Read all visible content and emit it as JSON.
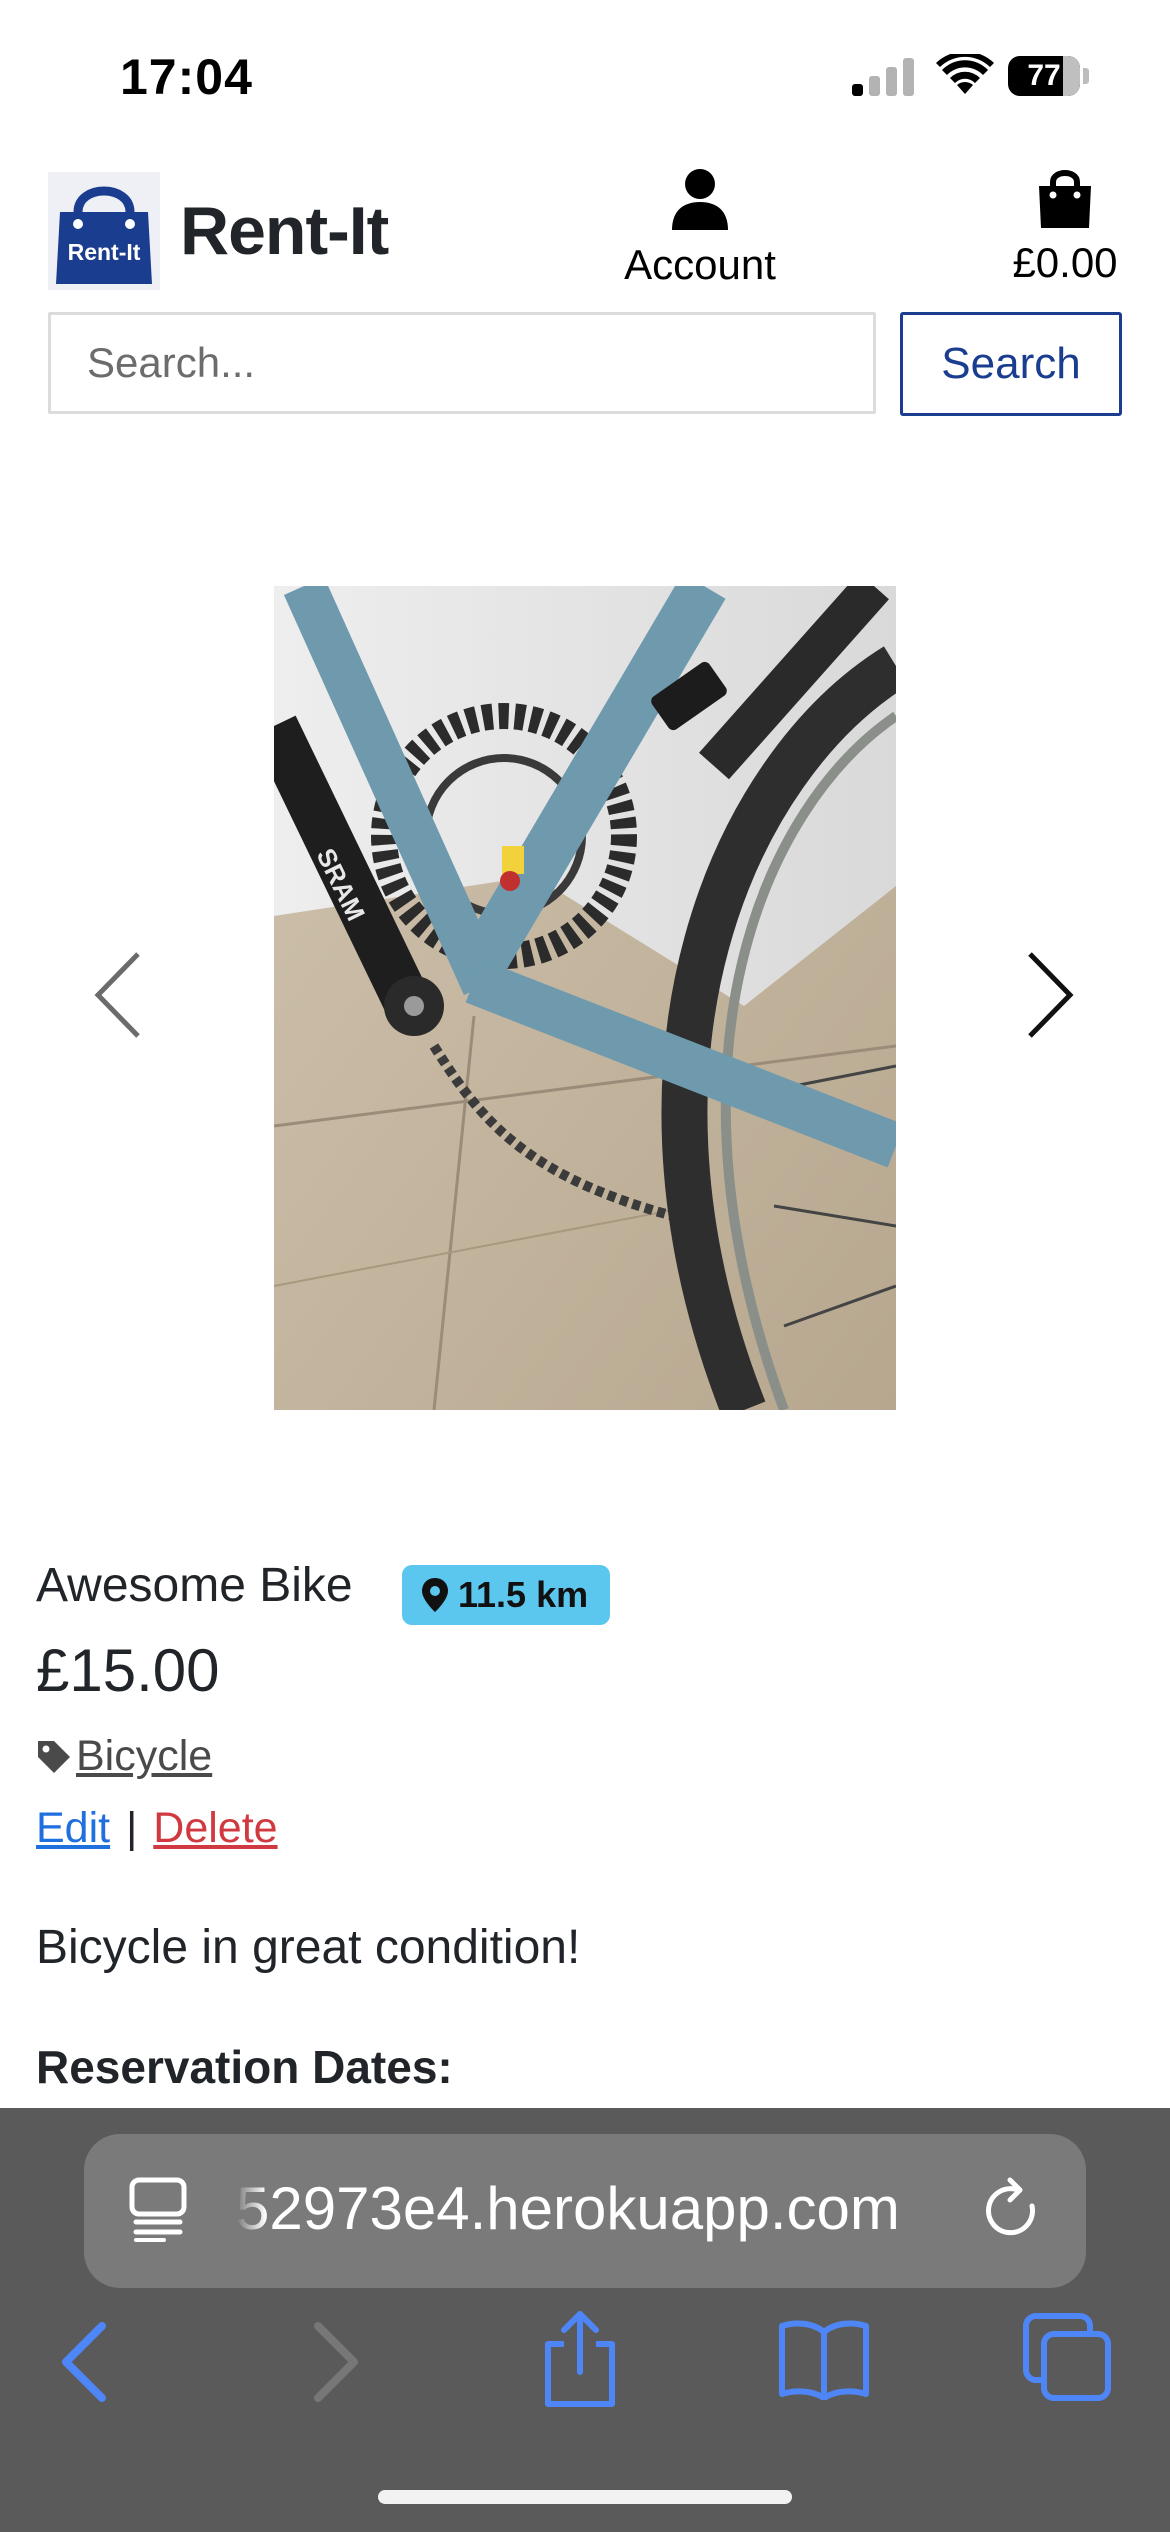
{
  "status_bar": {
    "time": "17:04",
    "battery": "77",
    "battery_level": 0.77
  },
  "header": {
    "logo_text": "Rent-It",
    "brand": "Rent-It",
    "account_label": "Account",
    "cart_total": "£0.00",
    "icons": {
      "account": "person-icon",
      "cart": "shopping-bag-icon"
    }
  },
  "search": {
    "placeholder": "Search...",
    "value": "",
    "button_label": "Search"
  },
  "carousel": {
    "prev_icon": "chevron-left-icon",
    "next_icon": "chevron-right-icon"
  },
  "product": {
    "title": "Awesome Bike",
    "distance": "11.5 km",
    "price": "£15.00",
    "category": "Bicycle",
    "edit_label": "Edit",
    "separator": "|",
    "delete_label": "Delete",
    "description": "Bicycle in great condition!",
    "reservation_heading": "Reservation Dates:"
  },
  "browser": {
    "url": "52973e4.herokuapp.com",
    "icons": [
      "page-icon",
      "reload-icon",
      "back-icon",
      "forward-icon",
      "share-icon",
      "bookmarks-icon",
      "tabs-icon"
    ]
  },
  "colors": {
    "brand_blue": "#1a3d8f",
    "badge": "#5bc6ee",
    "edit_link": "#1f6fde",
    "delete_link": "#d0393f",
    "browser_chrome": "#5a5a5a",
    "browser_accent": "#4f86f7"
  }
}
